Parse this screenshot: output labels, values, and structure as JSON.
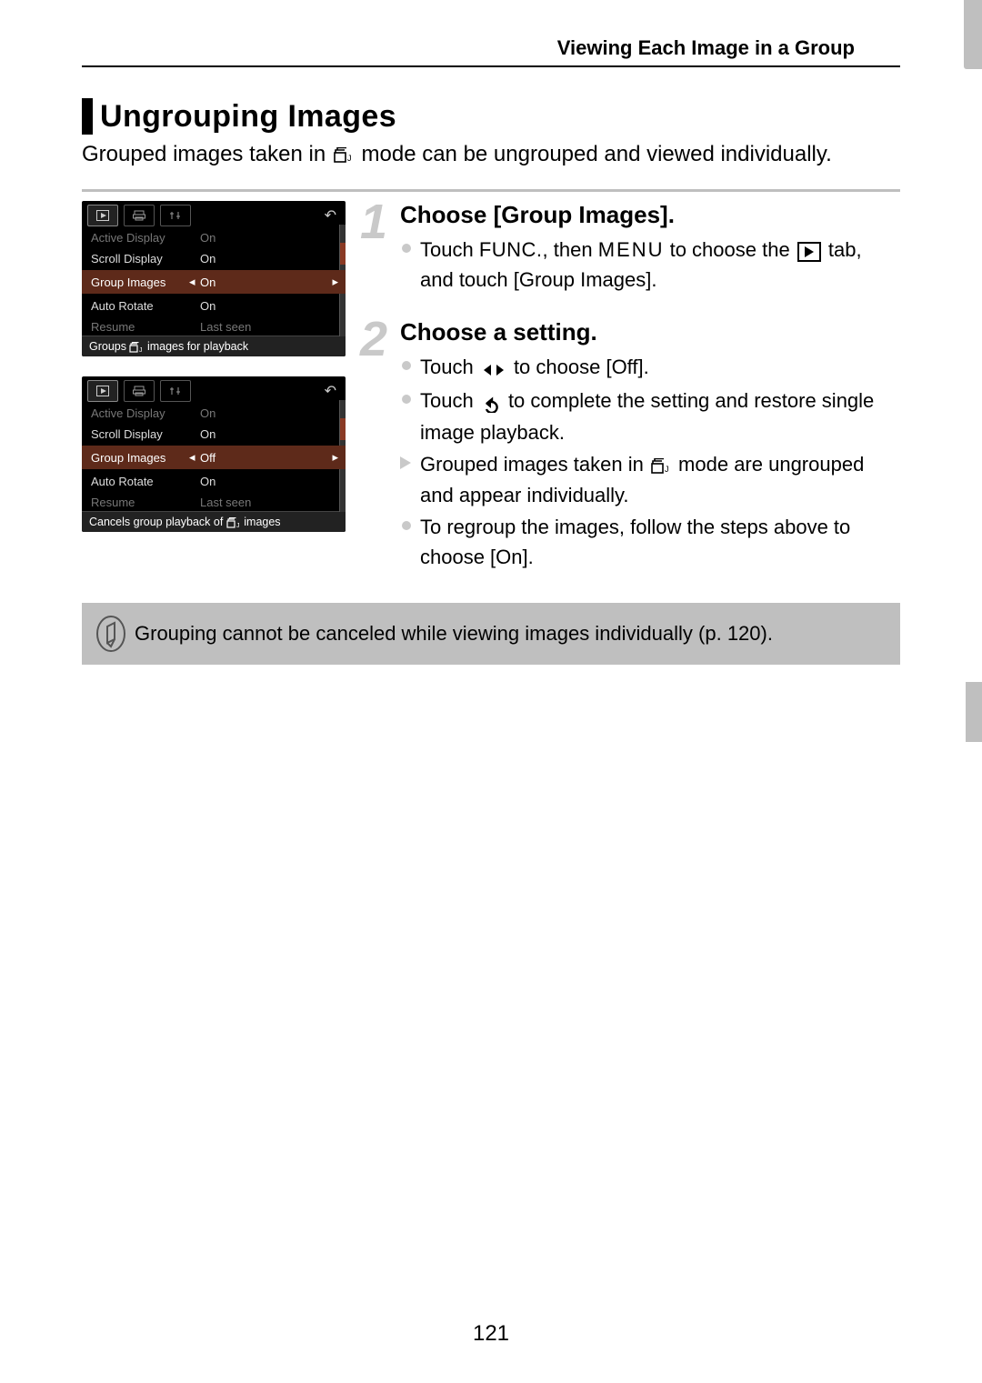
{
  "header": "Viewing Each Image in a Group",
  "section_title": "Ungrouping Images",
  "intro_before": "Grouped images taken in ",
  "intro_after": " mode can be ungrouped and viewed individually.",
  "screenshot1": {
    "rows": [
      {
        "label": "Active Display",
        "val": "On",
        "cut": true
      },
      {
        "label": "Scroll Display",
        "val": "On"
      },
      {
        "label": "Group Images",
        "val": "On",
        "sel": true
      },
      {
        "label": "Auto Rotate",
        "val": "On"
      },
      {
        "label": "Resume",
        "val": "Last seen",
        "cut": true
      }
    ],
    "hint_before": "Groups ",
    "hint_after": " images for playback"
  },
  "screenshot2": {
    "rows": [
      {
        "label": "Active Display",
        "val": "On",
        "cut": true
      },
      {
        "label": "Scroll Display",
        "val": "On"
      },
      {
        "label": "Group Images",
        "val": "Off",
        "sel": true
      },
      {
        "label": "Auto Rotate",
        "val": "On"
      },
      {
        "label": "Resume",
        "val": "Last seen",
        "cut": true
      }
    ],
    "hint_before": "Cancels group playback of ",
    "hint_after": " images"
  },
  "steps": [
    {
      "num": "1",
      "title": "Choose [Group Images].",
      "bullets": [
        {
          "type": "dot",
          "seg": [
            "Touch ",
            "FUNC.",
            ", then ",
            "MENU",
            " to choose the ",
            "PLAYTAB",
            " tab, and touch [Group Images]."
          ]
        }
      ]
    },
    {
      "num": "2",
      "title": "Choose a setting.",
      "bullets": [
        {
          "type": "dot",
          "seg": [
            "Touch ",
            "LRARROWS",
            " to choose [Off]."
          ]
        },
        {
          "type": "dot",
          "seg": [
            "Touch ",
            "BACKICON",
            " to complete the setting and restore single image playback."
          ]
        },
        {
          "type": "tri",
          "seg": [
            "Grouped images taken in ",
            "BURSTICON",
            " mode are ungrouped and appear individually."
          ]
        },
        {
          "type": "dot",
          "seg": [
            "To regroup the images, follow the steps above to choose [On]."
          ]
        }
      ]
    }
  ],
  "note": "Grouping cannot be canceled while viewing images individually (p. 120).",
  "page_num": "121"
}
